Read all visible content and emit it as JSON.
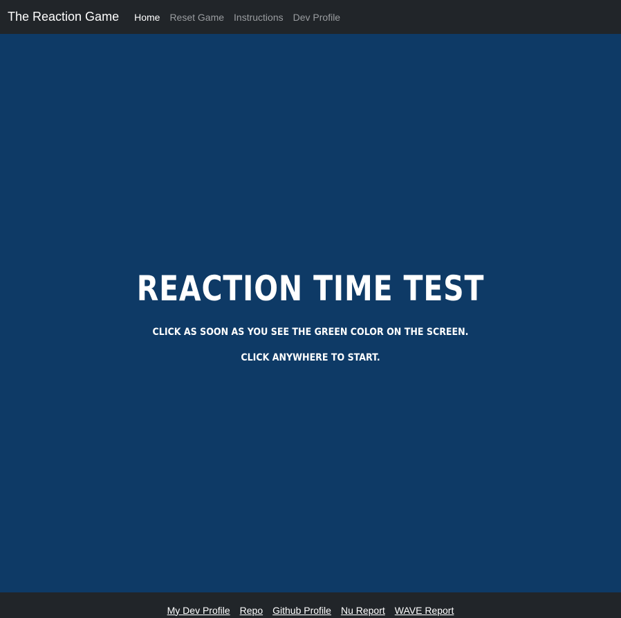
{
  "navbar": {
    "brand": "The Reaction Game",
    "links": [
      {
        "label": "Home",
        "active": true
      },
      {
        "label": "Reset Game",
        "active": false
      },
      {
        "label": "Instructions",
        "active": false
      },
      {
        "label": "Dev Profile",
        "active": false
      }
    ]
  },
  "main": {
    "title": "REACTION TIME TEST",
    "instruction": "CLICK AS SOON AS YOU SEE THE GREEN COLOR ON THE SCREEN.",
    "start_prompt": "CLICK ANYWHERE TO START.",
    "background_color": "#0e3a66"
  },
  "footer": {
    "links": [
      "My Dev Profile",
      "Repo",
      "Github Profile",
      "Nu Report",
      "WAVE Report"
    ]
  }
}
